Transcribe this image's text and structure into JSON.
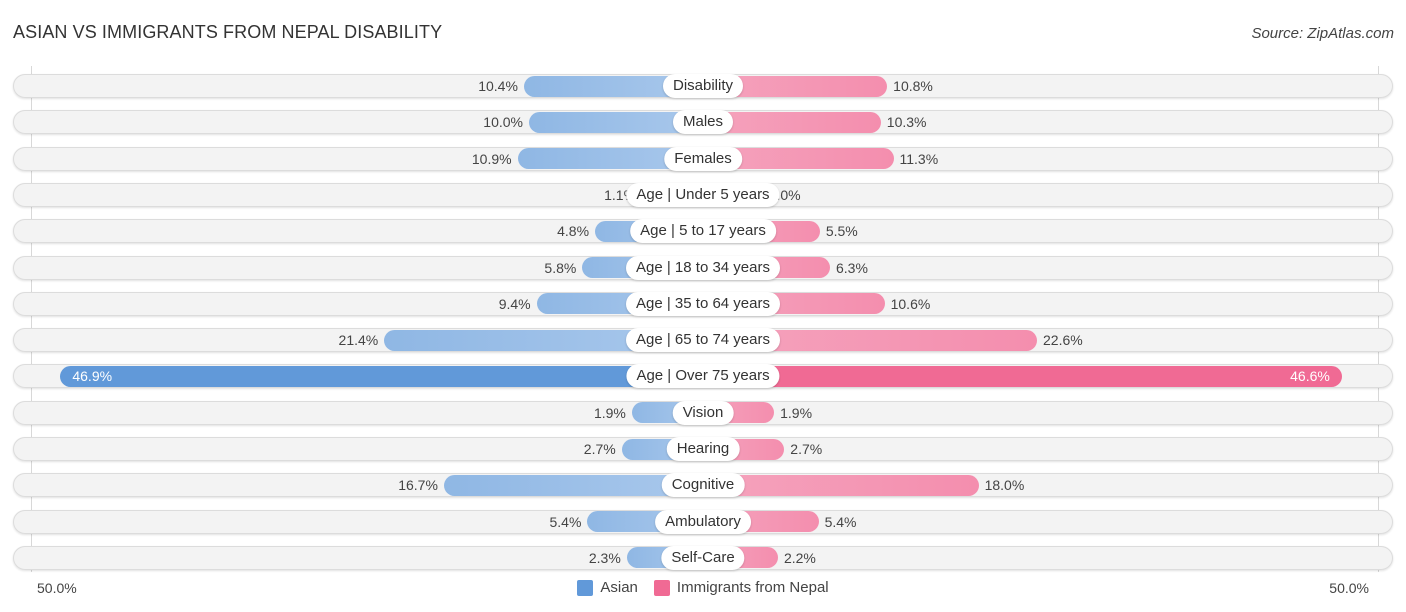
{
  "title": "ASIAN VS IMMIGRANTS FROM NEPAL DISABILITY",
  "source": "Source: ZipAtlas.com",
  "colors": {
    "asian": "#6199d9",
    "nepal": "#f06a94"
  },
  "chart_data": {
    "type": "bar",
    "orientation": "diverging-horizontal",
    "title": "ASIAN VS IMMIGRANTS FROM NEPAL DISABILITY",
    "categories": [
      "Disability",
      "Males",
      "Females",
      "Age | Under 5 years",
      "Age | 5 to 17 years",
      "Age | 18 to 34 years",
      "Age | 35 to 64 years",
      "Age | 65 to 74 years",
      "Age | Over 75 years",
      "Vision",
      "Hearing",
      "Cognitive",
      "Ambulatory",
      "Self-Care"
    ],
    "series": [
      {
        "name": "Asian",
        "side": "left",
        "values": [
          10.4,
          10.0,
          10.9,
          1.1,
          4.8,
          5.8,
          9.4,
          21.4,
          46.9,
          1.9,
          2.7,
          16.7,
          5.4,
          2.3
        ]
      },
      {
        "name": "Immigrants from Nepal",
        "side": "right",
        "values": [
          10.8,
          10.3,
          11.3,
          1.0,
          5.5,
          6.3,
          10.6,
          22.6,
          46.6,
          1.9,
          2.7,
          18.0,
          5.4,
          2.2
        ]
      }
    ],
    "value_suffix": "%",
    "axis_min_label": "50.0%",
    "axis_max_label": "50.0%",
    "xlim": [
      -50,
      50
    ],
    "legend": [
      "Asian",
      "Immigrants from Nepal"
    ],
    "legend_position": "bottom-center",
    "highlight_category": "Age | Over 75 years"
  }
}
